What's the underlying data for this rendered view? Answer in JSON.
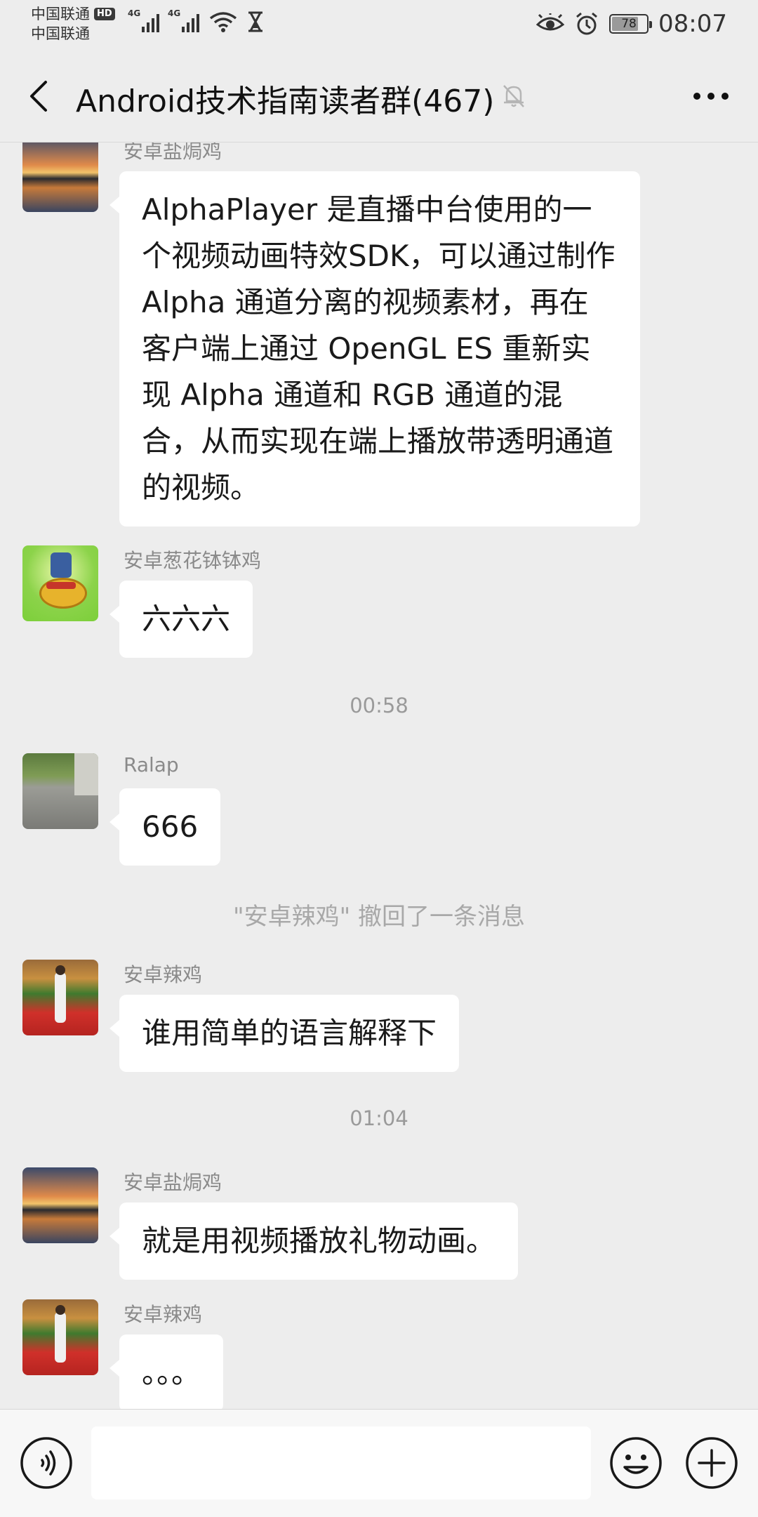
{
  "status_bar": {
    "carrier_1": "中国联通",
    "carrier_2": "中国联通",
    "hd_badge": "HD",
    "network_1": "4G",
    "network_2": "4G",
    "battery_level": "78",
    "battery_percent": 78,
    "time": "08:07"
  },
  "header": {
    "title": "Android技术指南读者群(467)"
  },
  "messages": [
    {
      "sender": "安卓盐焗鸡",
      "text": "AlphaPlayer 是直播中台使用的一个视频动画特效SDK，可以通过制作 Alpha 通道分离的视频素材，再在客户端上通过 OpenGL ES 重新实现 Alpha 通道和 RGB 通道的混合，从而实现在端上播放带透明通道的视频。"
    },
    {
      "sender": "安卓葱花钵钵鸡",
      "text": "六六六"
    },
    {
      "sender": "Ralap",
      "text": "666"
    },
    {
      "sender": "安卓辣鸡",
      "text": "谁用简单的语言解释下"
    },
    {
      "sender": "安卓盐焗鸡",
      "text": "就是用视频播放礼物动画。"
    },
    {
      "sender": "安卓辣鸡",
      "text": "。。。"
    }
  ],
  "timestamps": [
    "00:58",
    "01:04"
  ],
  "system_notices": [
    "\"安卓辣鸡\" 撤回了一条消息"
  ],
  "input": {
    "value": "",
    "placeholder": ""
  },
  "colors": {
    "background": "#ededed",
    "bubble": "#ffffff",
    "sender_name": "#8a8a8a",
    "timestamp": "#9a9a9a"
  },
  "icons": [
    "back-arrow-icon",
    "mute-bell-icon",
    "more-dots-icon",
    "voice-icon",
    "emoji-icon",
    "plus-icon",
    "eye-icon",
    "alarm-icon",
    "wifi-icon",
    "hourglass-icon"
  ]
}
